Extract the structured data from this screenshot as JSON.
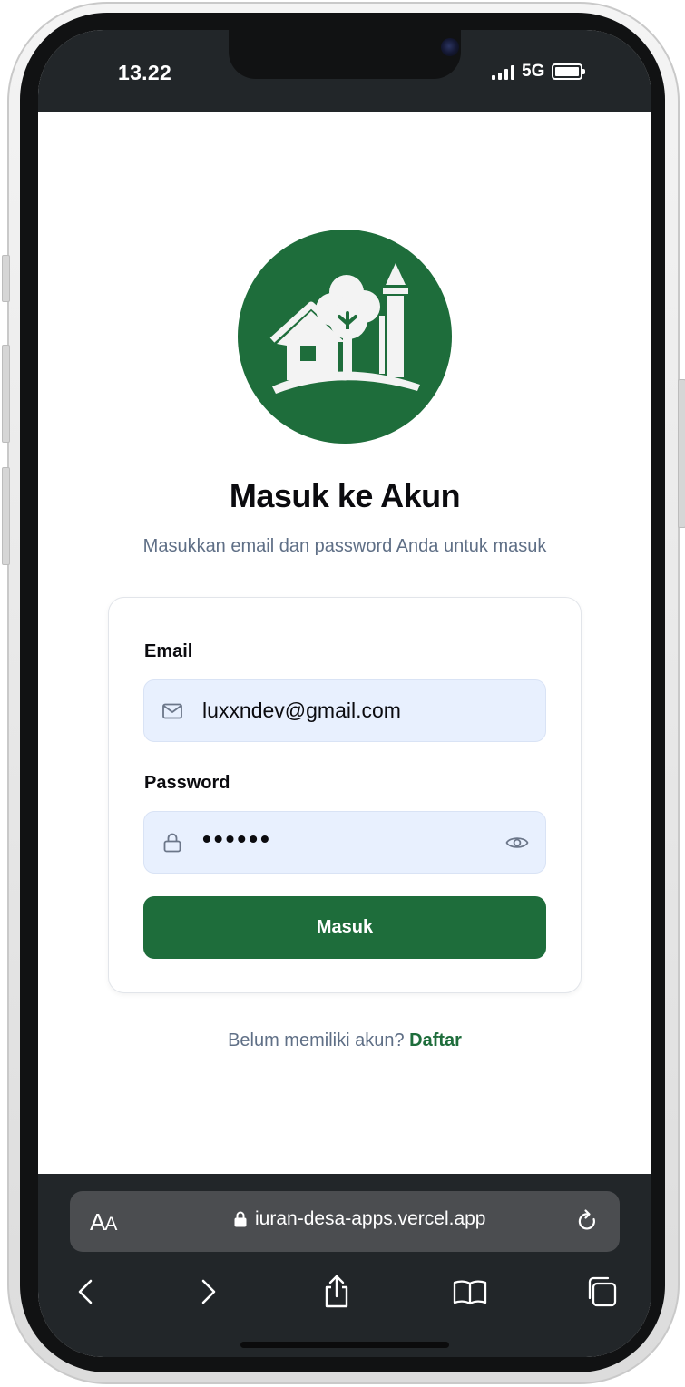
{
  "status_bar": {
    "time": "13.22",
    "network": "5G"
  },
  "page": {
    "title": "Masuk ke Akun",
    "subtitle": "Masukkan email dan password Anda untuk masuk"
  },
  "login_form": {
    "email_label": "Email",
    "email_value": "luxxndev@gmail.com",
    "password_label": "Password",
    "password_masked": "••••••",
    "submit_label": "Masuk"
  },
  "signup": {
    "prompt": "Belum memiliki akun?",
    "link_label": "Daftar"
  },
  "browser": {
    "text_size_label_big": "A",
    "text_size_label_small": "A",
    "url": "iuran-desa-apps.vercel.app"
  },
  "colors": {
    "brand_green": "#1e6d3b",
    "input_bg": "#e8f0fe",
    "muted_text": "#5f6f86",
    "browser_chrome": "#222629"
  },
  "icons": [
    "village-logo-icon",
    "mail-icon",
    "lock-icon",
    "eye-icon",
    "padlock-icon",
    "reload-icon",
    "back-icon",
    "forward-icon",
    "share-icon",
    "bookmarks-icon",
    "tabs-icon"
  ]
}
